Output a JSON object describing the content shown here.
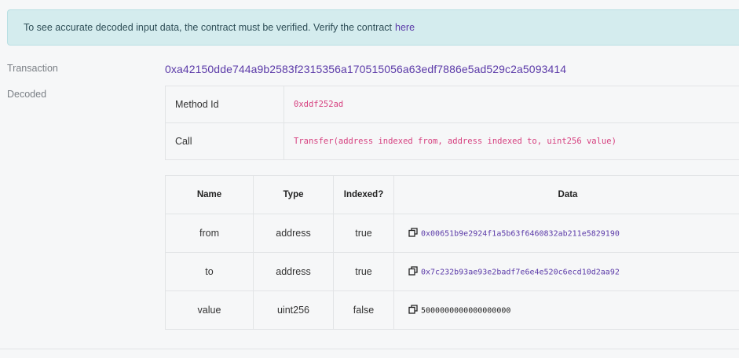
{
  "alert": {
    "text": "To see accurate decoded input data, the contract must be verified. Verify the contract",
    "link": "here"
  },
  "transaction": {
    "label": "Transaction",
    "hash": "0xa42150dde744a9b2583f2315356a170515056a63edf7886e5ad529c2a5093414"
  },
  "decoded": {
    "label": "Decoded",
    "method_id_label": "Method Id",
    "method_id": "0xddf252ad",
    "call_label": "Call",
    "call": "Transfer(address indexed from, address indexed to, uint256 value)"
  },
  "params": {
    "headers": [
      "Name",
      "Type",
      "Indexed?",
      "Data"
    ],
    "rows": [
      {
        "name": "from",
        "type": "address",
        "indexed": "true",
        "data": "0x00651b9e2924f1a5b63f6460832ab211e5829190"
      },
      {
        "name": "to",
        "type": "address",
        "indexed": "true",
        "data": "0x7c232b93ae93e2badf7e6e4e520c6ecd10d2aa92"
      },
      {
        "name": "value",
        "type": "uint256",
        "indexed": "false",
        "data": "5000000000000000000"
      }
    ]
  },
  "icons": {
    "copy": "copy-icon"
  },
  "colors": {
    "link": "#5b3aa8",
    "method": "#d6407f",
    "alert_bg": "#d4ecee"
  }
}
